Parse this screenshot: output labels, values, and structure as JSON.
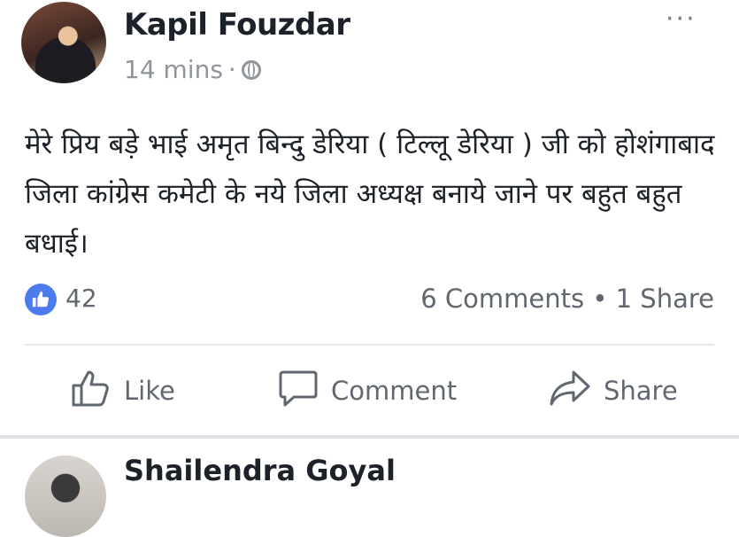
{
  "post": {
    "author": "Kapil Fouzdar",
    "time": "14 mins",
    "privacy_separator": "·",
    "privacy_icon": "globe-icon",
    "more_label": "···",
    "text": "मेरे प्रिय बड़े भाई अमृत बिन्दु डेरिया ( टिल्लू डेरिया ) जी को होशंगाबाद जिला कांग्रेस कमेटी के नये जिला अध्यक्ष बनाये जाने पर बहुत बहुत बधाई।",
    "reactions": {
      "icon": "thumbs-up-icon",
      "count": "42"
    },
    "counts_text": "6 Comments • 1 Share"
  },
  "actions": {
    "like": {
      "label": "Like",
      "icon": "like-outline-icon"
    },
    "comment": {
      "label": "Comment",
      "icon": "speech-bubble-icon"
    },
    "share": {
      "label": "Share",
      "icon": "share-arrow-icon"
    }
  },
  "next_post": {
    "author": "Shailendra Goyal"
  },
  "colors": {
    "reaction_blue": "#4b7bec",
    "muted_text": "#606770",
    "meta_text": "#90949c"
  }
}
